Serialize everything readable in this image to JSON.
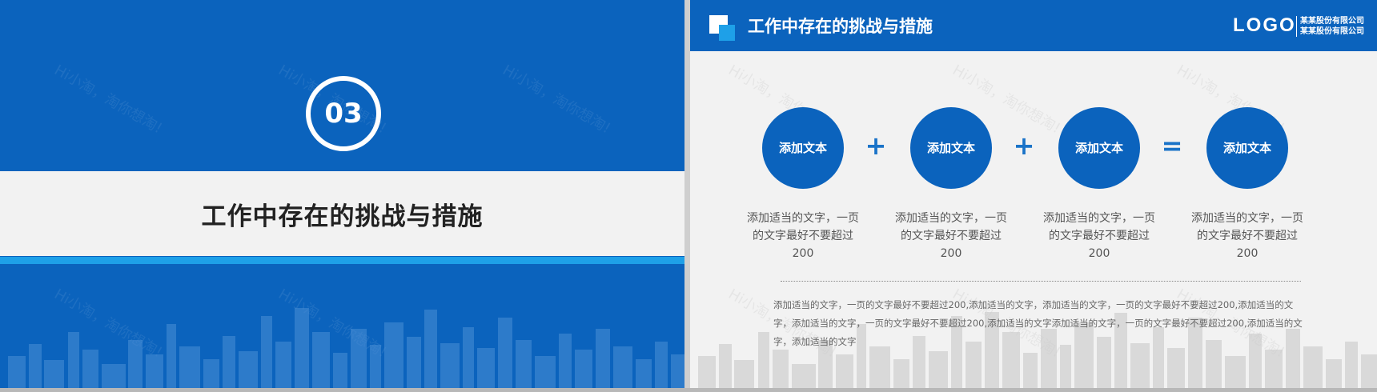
{
  "left_slide": {
    "number": "03",
    "title": "工作中存在的挑战与措施",
    "colors": {
      "primary": "#0b63bd",
      "accent": "#1ea0e8",
      "band": "#f2f2f2"
    }
  },
  "right_slide": {
    "header_title": "工作中存在的挑战与措施",
    "logo": "LOGO",
    "company_line1": "某某股份有限公司",
    "company_line2": "某某股份有限公司",
    "circles": [
      {
        "label": "添加文本",
        "desc": "添加适当的文字，一页的文字最好不要超过200"
      },
      {
        "label": "添加文本",
        "desc": "添加适当的文字，一页的文字最好不要超过200"
      },
      {
        "label": "添加文本",
        "desc": "添加适当的文字，一页的文字最好不要超过200"
      },
      {
        "label": "添加文本",
        "desc": "添加适当的文字，一页的文字最好不要超过200"
      }
    ],
    "operators": [
      "+",
      "+",
      "="
    ],
    "paragraph": "添加适当的文字，一页的文字最好不要超过200,添加适当的文字，添加适当的文字，一页的文字最好不要超过200,添加适当的文字，添加适当的文字，一页的文字最好不要超过200,添加适当的文字添加适当的文字，一页的文字最好不要超过200,添加适当的文字，添加适当的文字"
  },
  "watermark": "Hi小淘，淘你想淘!"
}
